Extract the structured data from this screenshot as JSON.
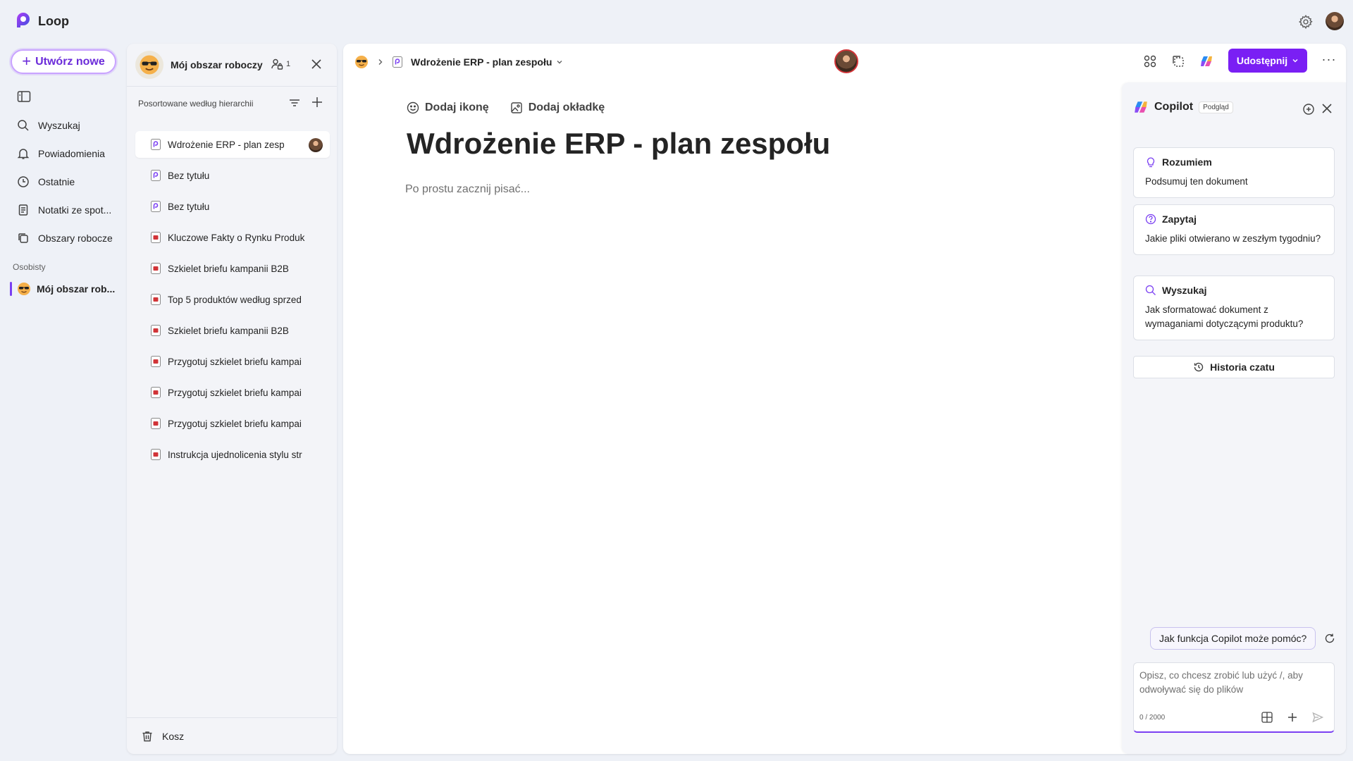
{
  "app": {
    "name": "Loop"
  },
  "nav": {
    "create_label": "Utwórz nowe",
    "items": [
      {
        "label": "Wyszukaj",
        "icon": "search-icon"
      },
      {
        "label": "Powiadomienia",
        "icon": "bell-icon"
      },
      {
        "label": "Ostatnie",
        "icon": "clock-icon"
      },
      {
        "label": "Notatki ze spot...",
        "icon": "notes-icon"
      },
      {
        "label": "Obszary robocze",
        "icon": "workspaces-icon"
      }
    ],
    "section_label": "Osobisty",
    "workspace_label": "Mój obszar rob..."
  },
  "tree": {
    "title": "Mój obszar roboczy",
    "member_count": "1",
    "sort_label": "Posortowane według hierarchii",
    "items": [
      {
        "label": "Wdrożenie ERP - plan zesp",
        "type": "loop-page",
        "active": true
      },
      {
        "label": "Bez tytułu",
        "type": "loop-page"
      },
      {
        "label": "Bez tytułu",
        "type": "loop-page"
      },
      {
        "label": "Kluczowe Fakty o Rynku Produk",
        "type": "pdf"
      },
      {
        "label": "Szkielet briefu kampanii B2B",
        "type": "pdf"
      },
      {
        "label": "Top 5 produktów według sprzed",
        "type": "pdf"
      },
      {
        "label": "Szkielet briefu kampanii B2B",
        "type": "pdf"
      },
      {
        "label": "Przygotuj szkielet briefu kampai",
        "type": "pdf"
      },
      {
        "label": "Przygotuj szkielet briefu kampai",
        "type": "pdf"
      },
      {
        "label": "Przygotuj szkielet briefu kampai",
        "type": "pdf"
      },
      {
        "label": "Instrukcja ujednolicenia stylu str",
        "type": "pdf"
      }
    ],
    "trash_label": "Kosz"
  },
  "document": {
    "breadcrumb_title": "Wdrożenie ERP - plan zespołu",
    "share_label": "Udostępnij",
    "add_icon_label": "Dodaj ikonę",
    "add_cover_label": "Dodaj okładkę",
    "title": "Wdrożenie ERP - plan zespołu",
    "placeholder": "Po prostu zacznij pisać..."
  },
  "copilot": {
    "title": "Copilot",
    "badge": "Podgląd",
    "cards": [
      {
        "heading": "Rozumiem",
        "body": "Podsumuj ten dokument",
        "icon": "lightbulb-icon"
      },
      {
        "heading": "Zapytaj",
        "body": "Jakie pliki otwierano w zeszłym tygodniu?",
        "icon": "question-icon"
      },
      {
        "heading": "Wyszukaj",
        "body": "Jak sformatować dokument z wymaganiami dotyczącymi produktu?",
        "icon": "search-icon"
      }
    ],
    "history_label": "Historia czatu",
    "help_prompt": "Jak funkcja Copilot może pomóc?",
    "input_placeholder": "Opisz, co chcesz zrobić lub użyć /, aby odwoływać się do plików",
    "counter": "0 / 2000"
  },
  "colors": {
    "accent": "#7a1ff4",
    "accent_light": "#c9a3ff",
    "active_bar": "#7a3ff2"
  }
}
